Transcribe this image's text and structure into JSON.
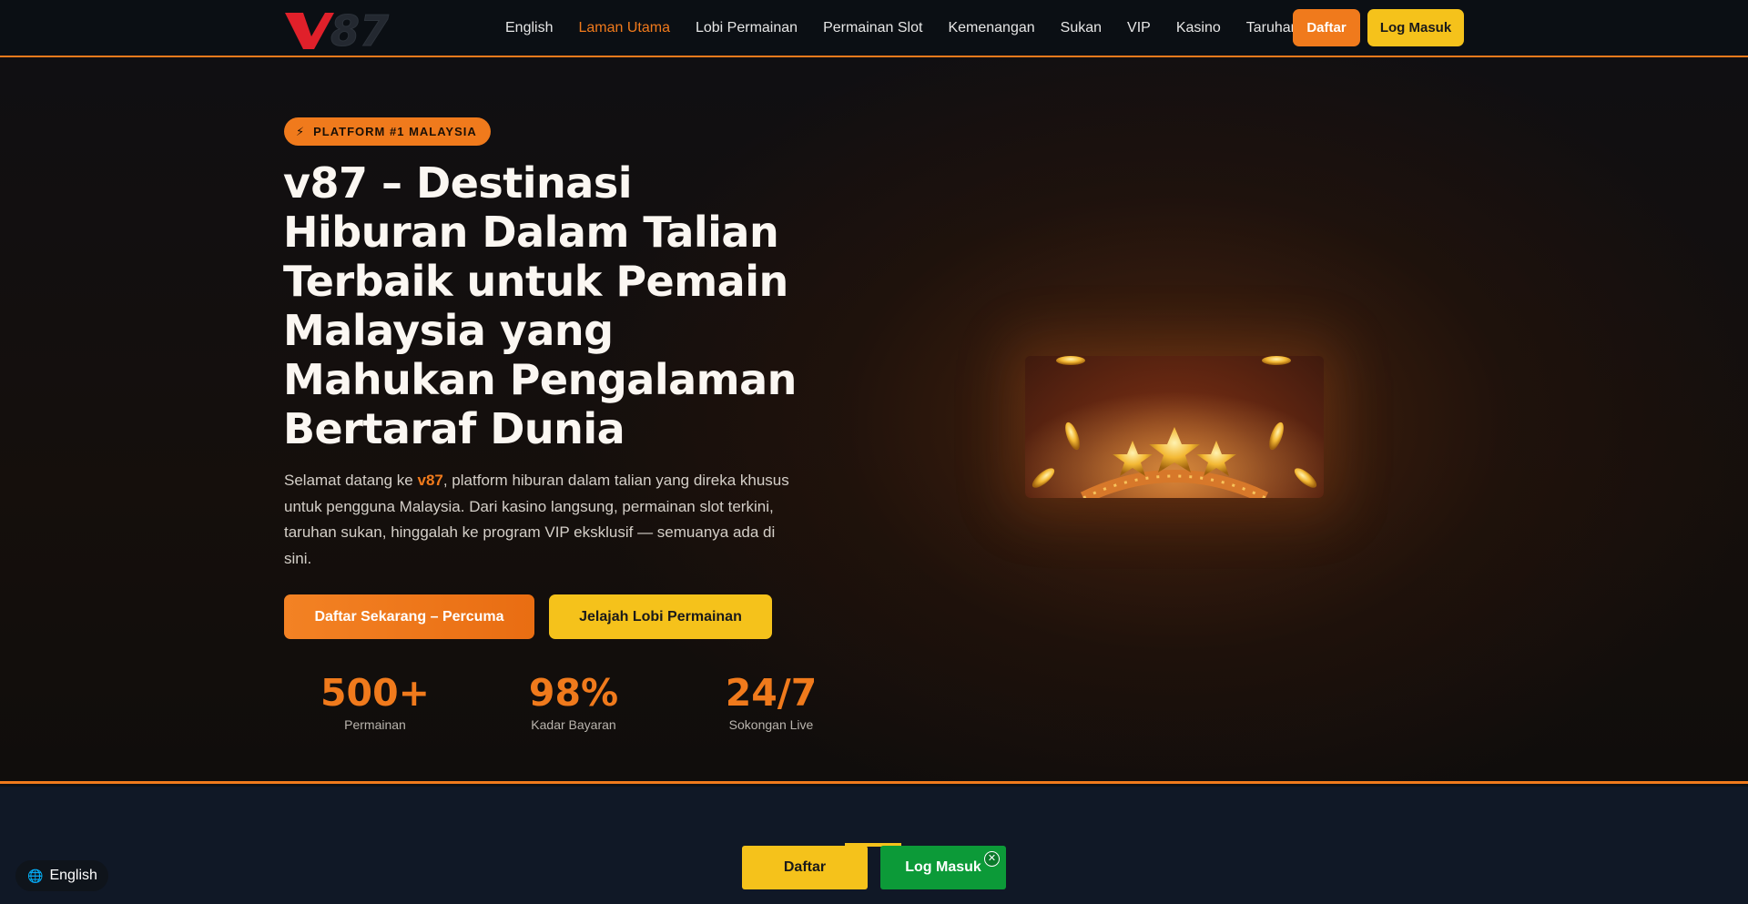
{
  "header": {
    "logo_text": "v87",
    "nav": [
      {
        "label": "English",
        "active": false
      },
      {
        "label": "Laman Utama",
        "active": true
      },
      {
        "label": "Lobi Permainan",
        "active": false
      },
      {
        "label": "Permainan Slot",
        "active": false
      },
      {
        "label": "Kemenangan",
        "active": false
      },
      {
        "label": "Sukan",
        "active": false
      },
      {
        "label": "VIP",
        "active": false
      },
      {
        "label": "Kasino",
        "active": false
      },
      {
        "label": "Taruhan",
        "active": false
      }
    ],
    "register_label": "Daftar",
    "login_label": "Log Masuk"
  },
  "hero": {
    "badge_icon": "bolt-icon",
    "badge": "PLATFORM #1 MALAYSIA",
    "title": "v87 – Destinasi Hiburan Dalam Talian Terbaik untuk Pemain Malaysia yang Mahukan Pengalaman Bertaraf Dunia",
    "desc_prefix": "Selamat datang ke ",
    "desc_brand": "v87",
    "desc_suffix": ", platform hiburan dalam talian yang direka khusus untuk pengguna Malaysia. Dari kasino langsung, permainan slot terkini, taruhan sukan, hinggalah ke program VIP eksklusif — semuanya ada di sini.",
    "cta_primary": "Daftar Sekarang – Percuma",
    "cta_secondary": "Jelajah Lobi Permainan",
    "stats": [
      {
        "value": "500+",
        "label": "Permainan"
      },
      {
        "value": "98%",
        "label": "Kadar Bayaran"
      },
      {
        "value": "24/7",
        "label": "Sokongan Live"
      }
    ]
  },
  "floating": {
    "language": "English",
    "register_label": "Daftar",
    "login_label": "Log Masuk",
    "close_icon": "close-icon"
  },
  "colors": {
    "accent_orange": "#f07a1c",
    "accent_yellow": "#f5c21b",
    "login_green": "#0c9a38",
    "background": "#0d1117"
  }
}
